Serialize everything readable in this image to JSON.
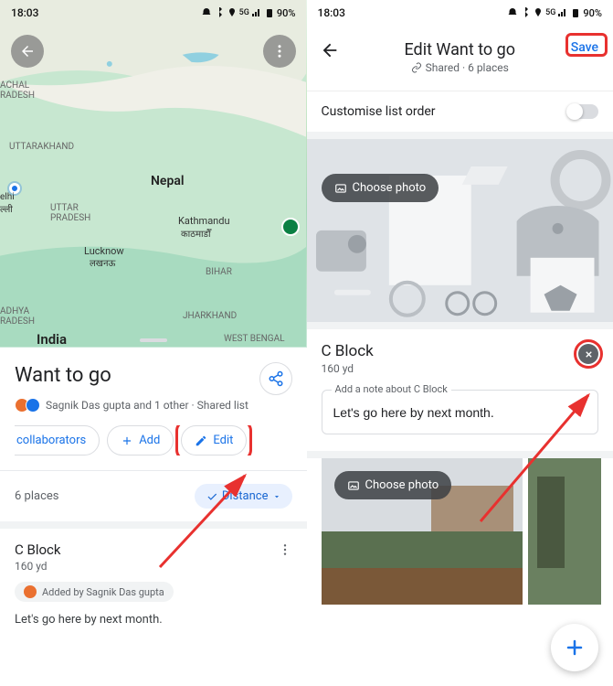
{
  "statusbar": {
    "time": "18:03",
    "battery": "90%"
  },
  "map": {
    "labels": {
      "nepal": "Nepal",
      "india": "India",
      "kathmandu": "Kathmandu",
      "kathmandu_native": "काठमाडौँ",
      "lucknow": "Lucknow",
      "lucknow_native": "लखनऊ",
      "uttar_pradesh": "UTTAR\nPRADESH",
      "uttarakhand": "UTTARAKHAND",
      "bihar": "BIHAR",
      "jharkhand": "JHARKHAND",
      "west_bengal": "WEST BENGAL",
      "achal_pradesh": "ACHAL\nRADESH",
      "adhya_pradesh": "ADHYA\nRADESH",
      "delhi": "elhi\nल्ली"
    }
  },
  "left_panel": {
    "title": "Want to go",
    "collab_text": "Sagnik Das gupta and 1 other · Shared list",
    "chips": {
      "invite": "ivite collaborators",
      "add": "Add",
      "edit": "Edit"
    },
    "places_count": "6 places",
    "sort": "Distance",
    "place": {
      "name": "C Block",
      "distance": "160 yd",
      "added_by": "Added by Sagnik Das gupta",
      "note": "Let's go here by next month."
    }
  },
  "right": {
    "title": "Edit Want to go",
    "subtitle": "Shared · 6 places",
    "save": "Save",
    "order": "Customise list order",
    "choose_photo": "Choose photo",
    "place": {
      "name": "C Block",
      "distance": "160 yd",
      "note_label": "Add a note about C Block",
      "note_value": "Let's go here by next month."
    }
  }
}
